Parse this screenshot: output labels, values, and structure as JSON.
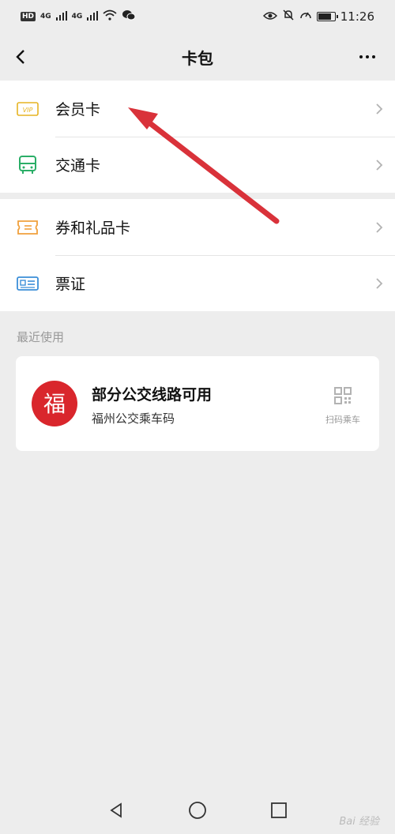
{
  "status_bar": {
    "left": [
      "HD",
      "4G",
      "4G"
    ],
    "time": "11:26"
  },
  "nav": {
    "title": "卡包"
  },
  "groups": [
    {
      "items": [
        {
          "label": "会员卡",
          "icon": "vip-icon"
        },
        {
          "label": "交通卡",
          "icon": "bus-icon"
        }
      ]
    },
    {
      "items": [
        {
          "label": "券和礼品卡",
          "icon": "ticket-icon"
        },
        {
          "label": "票证",
          "icon": "id-card-icon"
        }
      ]
    }
  ],
  "recent": {
    "section_label": "最近使用",
    "card": {
      "title": "部分公交线路可用",
      "subtitle": "福州公交乘车码",
      "action_label": "扫码乘车",
      "logo_text": "福"
    }
  },
  "watermark": "Bai 经验",
  "colors": {
    "accent_red": "#d9262c",
    "vip_yellow": "#e6b422",
    "bus_green": "#2aae67",
    "ticket_orange": "#f0a03c",
    "idcard_blue": "#3b8ed8"
  }
}
